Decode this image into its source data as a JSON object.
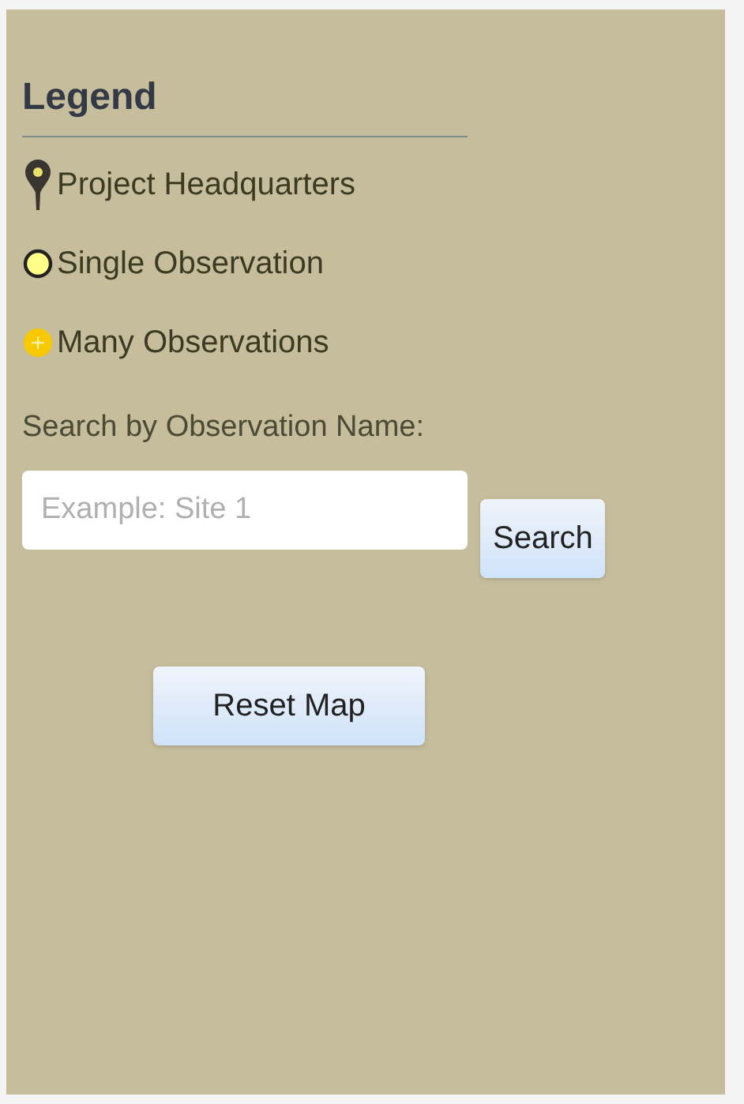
{
  "legend": {
    "title": "Legend",
    "items": [
      {
        "kind": "pin",
        "label": "Project Headquarters"
      },
      {
        "kind": "circle",
        "label": "Single Observation"
      },
      {
        "kind": "cluster",
        "label": "Many Observations"
      }
    ]
  },
  "search": {
    "label": "Search by Observation Name:",
    "placeholder": "Example: Site 1",
    "button": "Search"
  },
  "reset_button": "Reset Map"
}
